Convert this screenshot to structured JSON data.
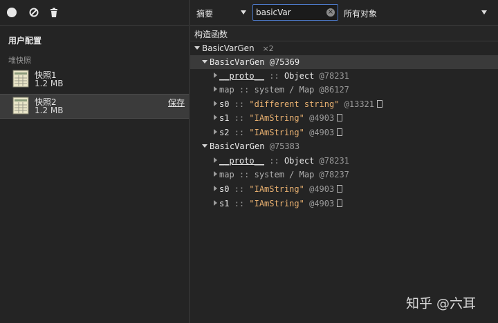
{
  "left_panel": {
    "profiles_label": "用户配置",
    "heap_label": "堆快照",
    "snapshots": [
      {
        "name": "快照1",
        "size": "1.2 MB"
      },
      {
        "name": "快照2",
        "size": "1.2 MB",
        "action": "保存"
      }
    ]
  },
  "toolbar": {
    "view_select": "摘要",
    "filter_value": "basicVar",
    "objects_select": "所有对象"
  },
  "column_header": "构造函数",
  "tree": {
    "group": {
      "name": "BasicVarGen",
      "count": "×2"
    },
    "instances": [
      {
        "name": "BasicVarGen",
        "id": "@75369",
        "props": [
          {
            "key": "__proto__",
            "sep": "::",
            "value": "Object",
            "id": "@78231"
          },
          {
            "key": "map",
            "sep": "::",
            "value": "system / Map",
            "id": "@86127"
          },
          {
            "key": "s0",
            "sep": "::",
            "value": "\"different string\"",
            "id": "@13321"
          },
          {
            "key": "s1",
            "sep": "::",
            "value": "\"IAmString\"",
            "id": "@4903"
          },
          {
            "key": "s2",
            "sep": "::",
            "value": "\"IAmString\"",
            "id": "@4903"
          }
        ]
      },
      {
        "name": "BasicVarGen",
        "id": "@75383",
        "props": [
          {
            "key": "__proto__",
            "sep": "::",
            "value": "Object",
            "id": "@78231"
          },
          {
            "key": "map",
            "sep": "::",
            "value": "system / Map",
            "id": "@78237"
          },
          {
            "key": "s0",
            "sep": "::",
            "value": "\"IAmString\"",
            "id": "@4903"
          },
          {
            "key": "s1",
            "sep": "::",
            "value": "\"IAmString\"",
            "id": "@4903"
          }
        ]
      }
    ]
  },
  "watermark": "知乎 @六耳",
  "colors": {
    "string": "#e8b070",
    "selected_row": "#3a3a3a",
    "filter_border": "#4c78c7"
  }
}
